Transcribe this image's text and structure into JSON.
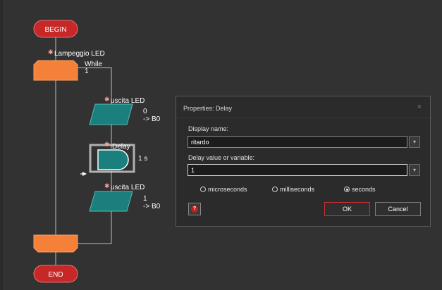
{
  "flowchart": {
    "begin_label": "BEGIN",
    "end_label": "END",
    "while_macro": {
      "name": "Lampeggio LED",
      "type": "While",
      "condition": "1"
    },
    "output1": {
      "name": "uscita LED",
      "value": "0",
      "target": "-> B0"
    },
    "delay": {
      "name": "Delay",
      "value": "1 s"
    },
    "output2": {
      "name": "uscita LED",
      "value": "1",
      "target": "-> B0"
    }
  },
  "dialog": {
    "title": "Properties: Delay",
    "close_glyph": "×",
    "display_name_label": "Display name:",
    "display_name_value": "ritardo",
    "delay_value_label": "Delay value or variable:",
    "delay_value": "1",
    "units": [
      {
        "label": "microseconds",
        "checked": false
      },
      {
        "label": "milliseconds",
        "checked": false
      },
      {
        "label": "seconds",
        "checked": true
      }
    ],
    "ok_label": "OK",
    "cancel_label": "Cancel",
    "dropdown_glyph": "▾",
    "help_glyph": "?"
  },
  "colors": {
    "background": "#323232",
    "terminal": "#c62828",
    "macro_orange": "#f5803a",
    "output_teal": "#1a7f7d",
    "ok_border": "#d03030"
  },
  "icons": [
    "star-icon",
    "arrow-right-icon",
    "chevron-down-icon",
    "help-icon",
    "close-icon"
  ]
}
